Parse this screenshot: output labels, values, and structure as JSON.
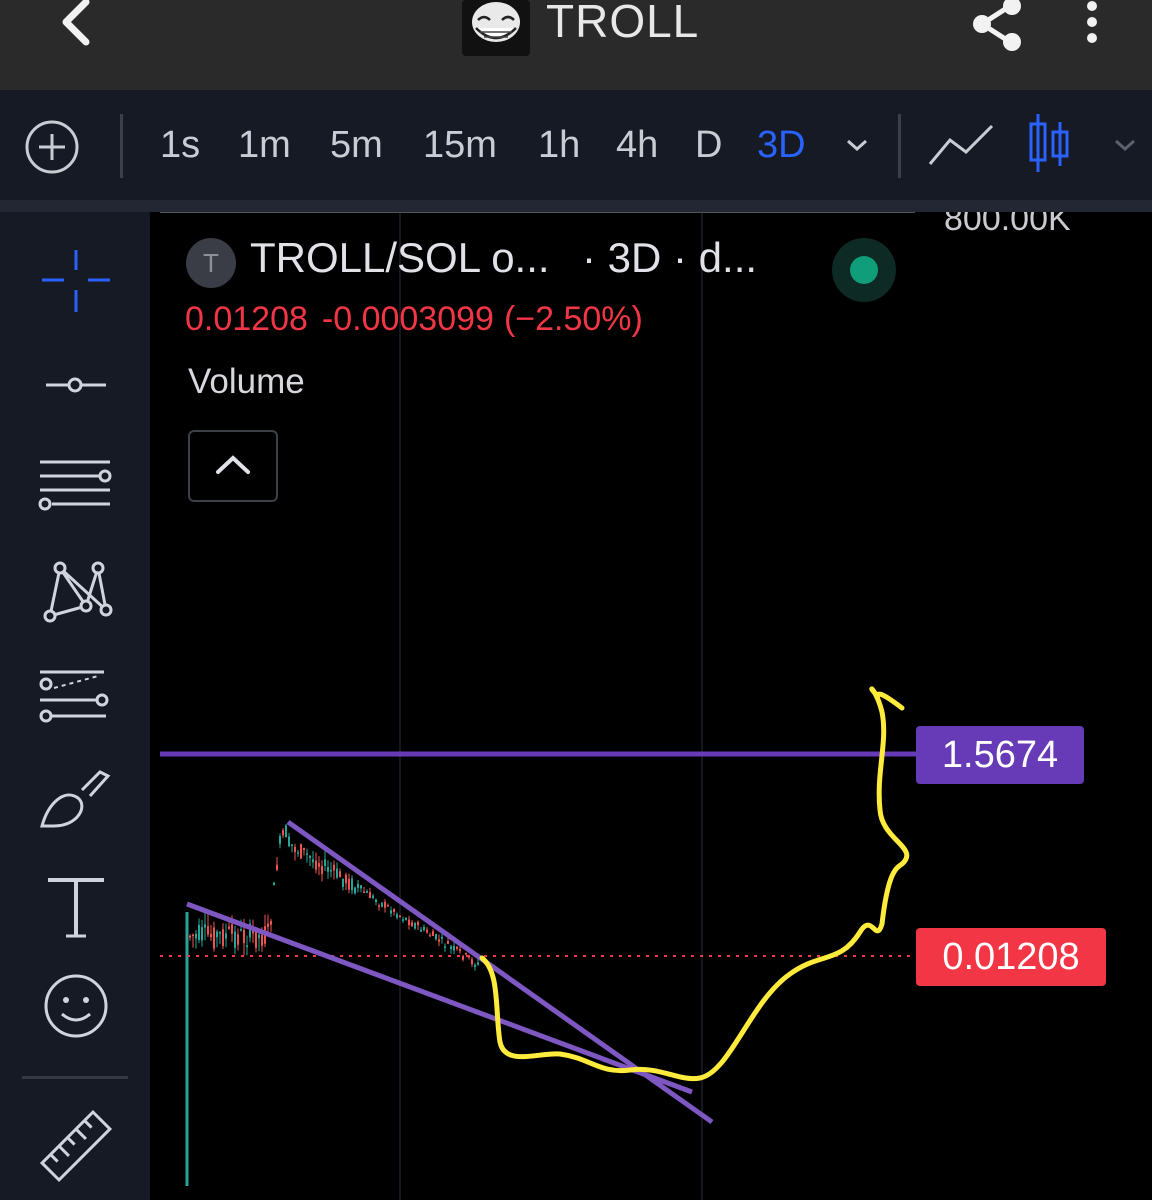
{
  "app_bar": {
    "title": "TROLL",
    "back_icon": "chevron-left-icon",
    "logo": "troll-face-logo",
    "share_icon": "share-icon",
    "more_icon": "more-vertical-icon"
  },
  "toolbar": {
    "intervals": [
      "1s",
      "1m",
      "5m",
      "15m",
      "1h",
      "4h",
      "D",
      "3D"
    ],
    "active_interval": "3D",
    "accent_color": "#2962ff"
  },
  "sidebar": {
    "tools": [
      "crosshair-icon",
      "horizontal-line-icon",
      "parallel-lines-icon",
      "pattern-icon",
      "fib-icon",
      "brush-icon",
      "text-icon",
      "emoji-icon",
      "ruler-icon"
    ]
  },
  "chart": {
    "symbol_avatar": "T",
    "symbol": "TROLL/SOL o...",
    "interval_info": "· 3D · d...",
    "last_price": "0.01208",
    "change": "-0.0003099",
    "change_pct": "(−2.50%)",
    "volume_label": "Volume",
    "axis_top_label": "800.00K",
    "horizontal_line_price": "1.5674",
    "current_price_tag": "0.01208",
    "colors": {
      "up": "#26a69a",
      "down": "#ef5350",
      "trendline": "#7e57c2",
      "hline": "#673ab7",
      "last_price": "#f23645",
      "annotation": "#ffeb3b"
    }
  }
}
